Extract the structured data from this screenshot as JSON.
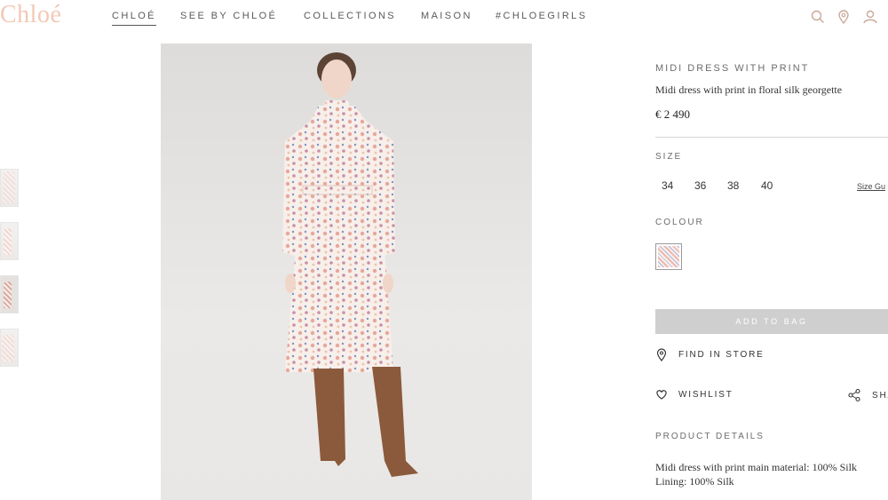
{
  "brand": {
    "logo": "Chloé"
  },
  "nav": {
    "items": [
      "CHLOÉ",
      "SEE BY CHLOÉ",
      "COLLECTIONS",
      "MAISON",
      "#CHLOEGIRLS"
    ],
    "active": "CHLOÉ"
  },
  "header_icons": [
    "search-icon",
    "location-pin-icon",
    "account-icon"
  ],
  "product": {
    "title": "MIDI DRESS WITH PRINT",
    "subtitle": "Midi dress with print in floral silk georgette",
    "price": "€ 2 490"
  },
  "size": {
    "label": "SIZE",
    "options": [
      "34",
      "36",
      "38",
      "40"
    ],
    "guide_link": "Size Gu"
  },
  "colour": {
    "label": "COLOUR"
  },
  "actions": {
    "add_to_bag": "ADD TO BAG",
    "find_in_store": "FIND IN STORE",
    "wishlist": "WISHLIST",
    "share": "SHA"
  },
  "details": {
    "label": "PRODUCT DETAILS",
    "line1": "Midi dress with print main material: 100% Silk",
    "line2": "Lining: 100% Silk"
  },
  "colors": {
    "logo": "#f2c9b6",
    "button_disabled": "#cfcfcf",
    "text": "#2b2b2b"
  }
}
